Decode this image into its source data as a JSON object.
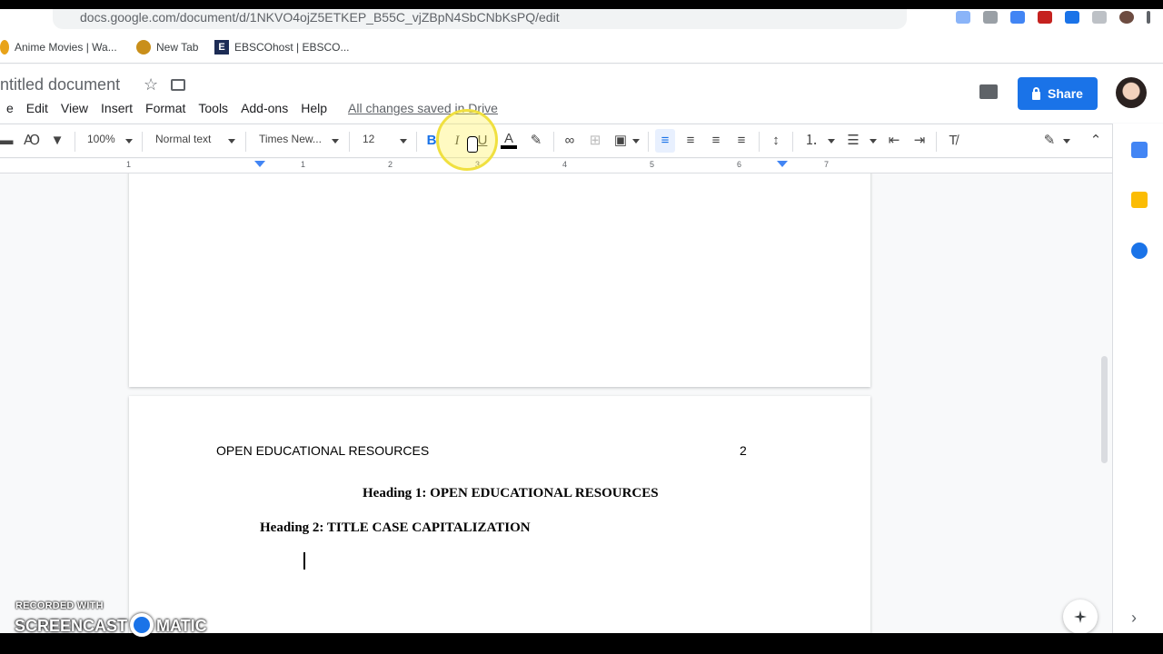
{
  "browser": {
    "url": "docs.google.com/document/d/1NKVO4ojZ5ETKEP_B55C_vjZBpN4SbCNbKsPQ/edit"
  },
  "bookmarks": [
    {
      "label": "Anime Movies | Wa..."
    },
    {
      "label": "New Tab"
    },
    {
      "label": "EBSCOhost | EBSCO..."
    }
  ],
  "doc": {
    "title": "ntitled document",
    "saved_status": "All changes saved in Drive",
    "menus": [
      "e",
      "Edit",
      "View",
      "Insert",
      "Format",
      "Tools",
      "Add-ons",
      "Help"
    ],
    "share_label": "Share"
  },
  "toolbar": {
    "zoom": "100%",
    "style": "Normal text",
    "font": "Times New...",
    "size": "12",
    "bold": "B",
    "italic": "I",
    "underline": "U",
    "text_color": "A"
  },
  "ruler": {
    "numbers": [
      "1",
      "1",
      "2",
      "3",
      "4",
      "5",
      "6",
      "7"
    ]
  },
  "page": {
    "running_head": "OPEN EDUCATIONAL RESOURCES",
    "page_number": "2",
    "heading1": "Heading 1: OPEN EDUCATIONAL RESOURCES",
    "heading2": "Heading 2: TITLE CASE CAPITALIZATION"
  },
  "watermark": {
    "line1": "RECORDED WITH",
    "brand_left": "SCREENCAST",
    "brand_right": "MATIC"
  },
  "colors": {
    "share": "#1a73e8",
    "highlight": "#f0e040"
  },
  "icons": {
    "sidebar": [
      "calendar-icon",
      "keep-icon",
      "tasks-icon"
    ]
  }
}
